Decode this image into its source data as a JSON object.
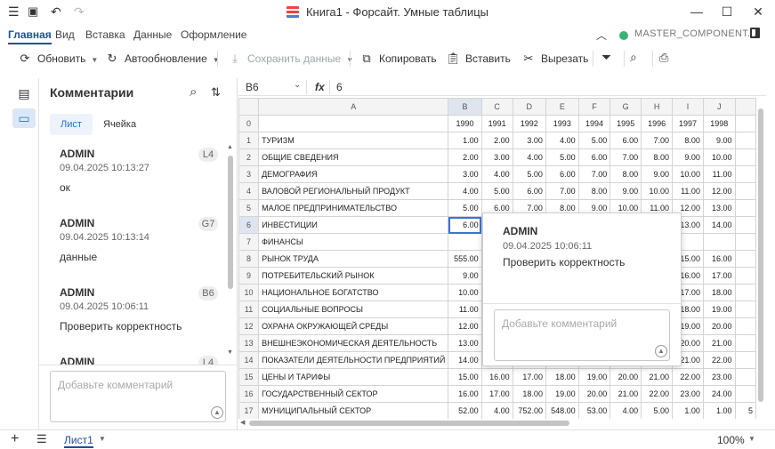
{
  "titlebar": {
    "title": "Книга1 - Форсайт. Умные таблицы"
  },
  "menu": [
    "Главная",
    "Вид",
    "Вставка",
    "Данные",
    "Оформление"
  ],
  "connection": {
    "name": "MASTER_COMPONENT...",
    "status_color": "#3cb371"
  },
  "toolbar": {
    "refresh": "Обновить",
    "autorefresh": "Автообновление",
    "save_data": "Сохранить данные",
    "copy": "Копировать",
    "paste": "Вставить",
    "cut": "Вырезать"
  },
  "comments_panel": {
    "title": "Комментарии",
    "tabs": [
      "Лист",
      "Ячейка"
    ],
    "comments": [
      {
        "user": "ADMIN",
        "time": "09.04.2025 10:13:27",
        "text": "ок",
        "cell": "L4"
      },
      {
        "user": "ADMIN",
        "time": "09.04.2025 10:13:14",
        "text": "данные",
        "cell": "G7"
      },
      {
        "user": "ADMIN",
        "time": "09.04.2025 10:06:11",
        "text": "Проверить корректность",
        "cell": "B6"
      },
      {
        "user": "ADMIN",
        "time": "",
        "text": "",
        "cell": "L4"
      }
    ],
    "input_placeholder": "Добавьте комментарий"
  },
  "formula_bar": {
    "cell_ref": "B6",
    "fx": "fx",
    "value": "6"
  },
  "grid": {
    "col_headers": [
      "A",
      "B",
      "C",
      "D",
      "E",
      "F",
      "G",
      "H",
      "I",
      "J"
    ],
    "years": [
      "1990",
      "1991",
      "1992",
      "1993",
      "1994",
      "1995",
      "1996",
      "1997",
      "1998"
    ],
    "rows": [
      {
        "n": "1",
        "label": "ТУРИЗМ",
        "v": [
          "1.00",
          "2.00",
          "3.00",
          "4.00",
          "5.00",
          "6.00",
          "7.00",
          "8.00",
          "9.00"
        ]
      },
      {
        "n": "2",
        "label": "ОБЩИЕ СВЕДЕНИЯ",
        "v": [
          "2.00",
          "3.00",
          "4.00",
          "5.00",
          "6.00",
          "7.00",
          "8.00",
          "9.00",
          "10.00"
        ]
      },
      {
        "n": "3",
        "label": "ДЕМОГРАФИЯ",
        "v": [
          "3.00",
          "4.00",
          "5.00",
          "6.00",
          "7.00",
          "8.00",
          "9.00",
          "10.00",
          "11.00"
        ]
      },
      {
        "n": "4",
        "label": "ВАЛОВОЙ РЕГИОНАЛЬНЫЙ ПРОДУКТ",
        "v": [
          "4.00",
          "5.00",
          "6.00",
          "7.00",
          "8.00",
          "9.00",
          "10.00",
          "11.00",
          "12.00"
        ]
      },
      {
        "n": "5",
        "label": "МАЛОЕ ПРЕДПРИНИМАТЕЛЬСТВО",
        "v": [
          "5.00",
          "6.00",
          "7.00",
          "8.00",
          "9.00",
          "10.00",
          "11.00",
          "12.00",
          "13.00"
        ]
      },
      {
        "n": "6",
        "label": "ИНВЕСТИЦИИ",
        "v": [
          "6.00",
          "",
          "",
          "",
          "",
          "",
          "",
          "13.00",
          "14.00"
        ]
      },
      {
        "n": "7",
        "label": "ФИНАНСЫ",
        "v": [
          "",
          "",
          "",
          "",
          "",
          "",
          "",
          "",
          ""
        ]
      },
      {
        "n": "8",
        "label": "РЫНОК ТРУДА",
        "v": [
          "555.00",
          "",
          "",
          "",
          "",
          "",
          "",
          "15.00",
          "16.00"
        ]
      },
      {
        "n": "9",
        "label": "ПОТРЕБИТЕЛЬСКИЙ РЫНОК",
        "v": [
          "9.00",
          "",
          "",
          "",
          "",
          "",
          "",
          "16.00",
          "17.00"
        ]
      },
      {
        "n": "10",
        "label": "НАЦИОНАЛЬНОЕ БОГАТСТВО",
        "v": [
          "10.00",
          "",
          "",
          "",
          "",
          "",
          "",
          "17.00",
          "18.00"
        ]
      },
      {
        "n": "11",
        "label": "СОЦИАЛЬНЫЕ ВОПРОСЫ",
        "v": [
          "11.00",
          "",
          "",
          "",
          "",
          "",
          "",
          "18.00",
          "19.00"
        ]
      },
      {
        "n": "12",
        "label": "ОХРАНА ОКРУЖАЮЩЕЙ СРЕДЫ",
        "v": [
          "12.00",
          "",
          "",
          "",
          "",
          "",
          "",
          "19.00",
          "20.00"
        ]
      },
      {
        "n": "13",
        "label": "ВНЕШНЕЭКОНОМИЧЕСКАЯ ДЕЯТЕЛЬНОСТЬ",
        "v": [
          "13.00",
          "",
          "",
          "",
          "",
          "",
          "",
          "20.00",
          "21.00"
        ]
      },
      {
        "n": "14",
        "label": "ПОКАЗАТЕЛИ ДЕЯТЕЛЬНОСТИ ПРЕДПРИЯТИЙ",
        "v": [
          "14.00",
          "",
          "",
          "",
          "",
          "",
          "",
          "21.00",
          "22.00"
        ]
      },
      {
        "n": "15",
        "label": "ЦЕНЫ И ТАРИФЫ",
        "v": [
          "15.00",
          "16.00",
          "17.00",
          "18.00",
          "19.00",
          "20.00",
          "21.00",
          "22.00",
          "23.00"
        ]
      },
      {
        "n": "16",
        "label": "ГОСУДАРСТВЕННЫЙ СЕКТОР",
        "v": [
          "16.00",
          "17.00",
          "18.00",
          "19.00",
          "20.00",
          "21.00",
          "22.00",
          "23.00",
          "24.00"
        ]
      },
      {
        "n": "17",
        "label": "МУНИЦИПАЛЬНЫЙ СЕКТОР",
        "v": [
          "52.00",
          "4.00",
          "752.00",
          "548.00",
          "53.00",
          "4.00",
          "5.00",
          "1.00",
          "1.00"
        ]
      }
    ],
    "overflow_fragment": "5"
  },
  "popup": {
    "user": "ADMIN",
    "time": "09.04.2025 10:06:11",
    "text": "Проверить корректность",
    "input_placeholder": "Добавьте комментарий"
  },
  "status": {
    "sheet": "Лист1",
    "zoom": "100%"
  }
}
